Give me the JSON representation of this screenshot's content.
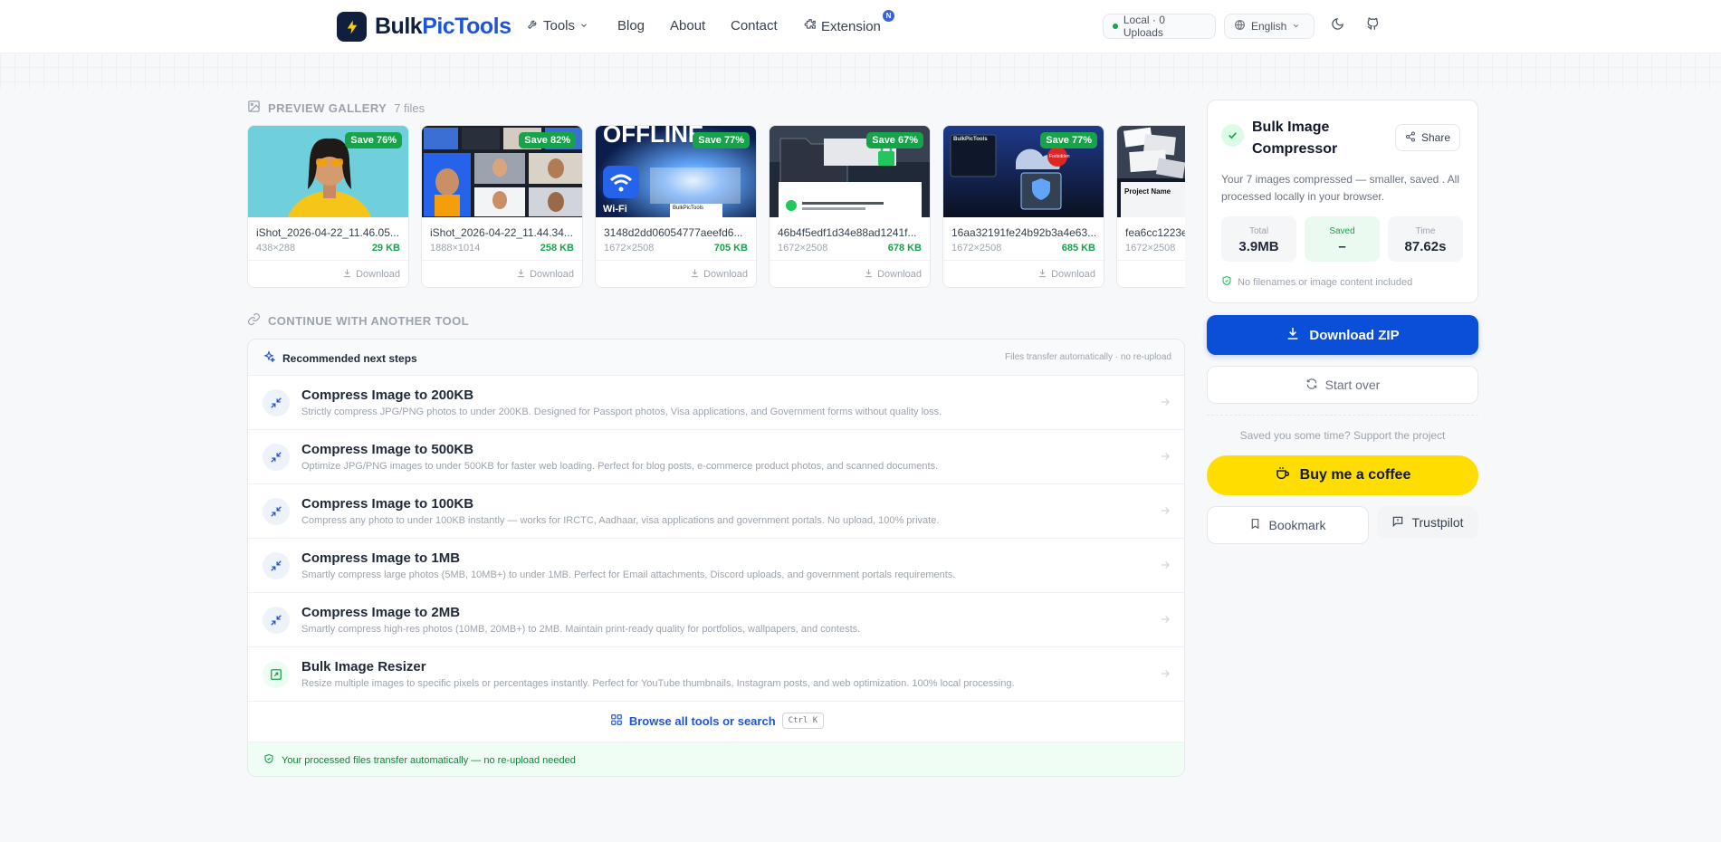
{
  "nav": {
    "logo_part1": "Bulk",
    "logo_part2": "PicTools",
    "tools": "Tools",
    "blog": "Blog",
    "about": "About",
    "contact": "Contact",
    "extension": "Extension",
    "extension_badge": "N",
    "status": "Local · 0 Uploads",
    "language": "English"
  },
  "gallery": {
    "title": "PREVIEW GALLERY",
    "count": "7 files",
    "download_label": "Download",
    "items": [
      {
        "name": "iShot_2026-04-22_11.46.05...",
        "dims": "438×288",
        "size": "29 KB",
        "save": "Save 76%"
      },
      {
        "name": "iShot_2026-04-22_11.44.34...",
        "dims": "1888×1014",
        "size": "258 KB",
        "save": "Save 82%"
      },
      {
        "name": "3148d2dd06054777aeefd6...",
        "dims": "1672×2508",
        "size": "705 KB",
        "save": "Save 77%"
      },
      {
        "name": "46b4f5edf1d34e88ad1241f...",
        "dims": "1672×2508",
        "size": "678 KB",
        "save": "Save 67%"
      },
      {
        "name": "16aa32191fe24b92b3a4e63...",
        "dims": "1672×2508",
        "size": "685 KB",
        "save": "Save 77%"
      },
      {
        "name": "fea6cc1223e",
        "dims": "1672×2508",
        "size": "",
        "save": ""
      }
    ],
    "thumb_texts": {
      "offline": "OFFLINE",
      "wifi": "Wi-Fi",
      "brand": "BulkPicTools",
      "project": "Project Name",
      "forbidden": "Forbidden"
    }
  },
  "tools": {
    "section_title": "CONTINUE WITH ANOTHER TOOL",
    "panel_title": "Recommended next steps",
    "panel_note": "Files transfer automatically · no re-upload",
    "rows": [
      {
        "title": "Compress Image to 200KB",
        "desc": "Strictly compress JPG/PNG photos to under 200KB. Designed for Passport photos, Visa applications, and Government forms without quality loss."
      },
      {
        "title": "Compress Image to 500KB",
        "desc": "Optimize JPG/PNG images to under 500KB for faster web loading. Perfect for blog posts, e-commerce product photos, and scanned documents."
      },
      {
        "title": "Compress Image to 100KB",
        "desc": "Compress any photo to under 100KB instantly — works for IRCTC, Aadhaar, visa applications and government portals. No upload, 100% private."
      },
      {
        "title": "Compress Image to 1MB",
        "desc": "Smartly compress large photos (5MB, 10MB+) to under 1MB. Perfect for Email attachments, Discord uploads, and government portals requirements."
      },
      {
        "title": "Compress Image to 2MB",
        "desc": "Smartly compress high-res photos (10MB, 20MB+) to 2MB. Maintain print-ready quality for portfolios, wallpapers, and contests."
      },
      {
        "title": "Bulk Image Resizer",
        "desc": "Resize multiple images to specific pixels or percentages instantly. Perfect for YouTube thumbnails, Instagram posts, and web optimization. 100% local processing."
      }
    ],
    "browse_label": "Browse all tools or search",
    "shortcut": "Ctrl K",
    "footer": "Your processed files transfer automatically — no re-upload needed"
  },
  "summary": {
    "title": "Bulk Image Compressor",
    "share": "Share",
    "desc": "Your 7 images compressed — smaller, saved . All processed locally in your browser.",
    "stats": [
      {
        "label": "Total",
        "value": "3.9MB"
      },
      {
        "label": "Saved",
        "value": "–"
      },
      {
        "label": "Time",
        "value": "87.62s"
      }
    ],
    "privacy": "No filenames or image content included"
  },
  "actions": {
    "download_zip": "Download ZIP",
    "start_over": "Start over",
    "support_text": "Saved you some time? Support the project",
    "coffee": "Buy me a coffee",
    "bookmark": "Bookmark",
    "trustpilot": "Trustpilot"
  },
  "colors": {
    "primary": "#0b4fd8",
    "success": "#16a34a",
    "coffee": "#ffdd00",
    "brand_dark": "#0f1f3d"
  }
}
